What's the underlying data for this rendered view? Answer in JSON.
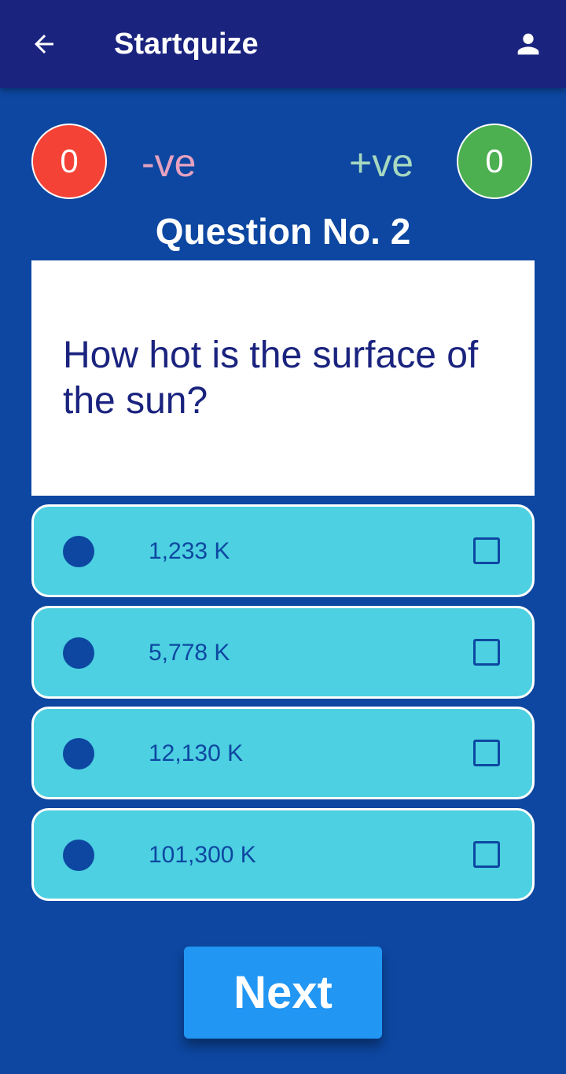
{
  "app_bar": {
    "title": "Startquize",
    "back_icon": "arrow-left-icon",
    "profile_icon": "person-icon"
  },
  "score": {
    "negative_count": "0",
    "negative_label": "-ve",
    "positive_count": "0",
    "positive_label": "+ve"
  },
  "question": {
    "number_label": "Question No. 2",
    "text": "How hot is the surface of the sun?"
  },
  "options": [
    {
      "label": "1,233 K"
    },
    {
      "label": "5,778 K"
    },
    {
      "label": "12,130 K"
    },
    {
      "label": "101,300 K"
    }
  ],
  "actions": {
    "next_label": "Next"
  },
  "colors": {
    "background": "#0d47a1",
    "app_bar": "#1a237e",
    "negative": "#f44336",
    "positive": "#4caf50",
    "option_bg": "#4dd0e1",
    "next_button": "#2196f3"
  }
}
